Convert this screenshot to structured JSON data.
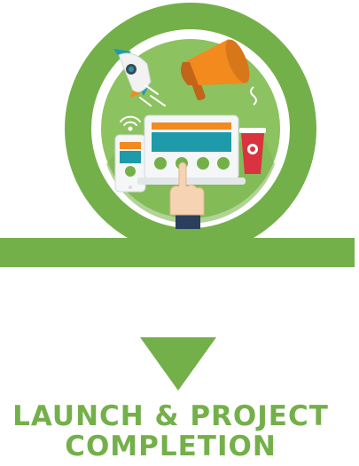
{
  "caption": {
    "line1": "LAUNCH & PROJECT",
    "line2": "COMPLETION"
  },
  "colors": {
    "green": "#74b04a",
    "green_light": "#8cc260",
    "orange": "#f28a1e",
    "teal": "#1e9aab",
    "red": "#d9333f"
  },
  "icons": [
    "rocket-icon",
    "megaphone-icon",
    "wifi-icon",
    "smartphone-icon",
    "laptop-icon",
    "pointing-hand-icon",
    "cup-icon",
    "down-arrow-icon"
  ]
}
